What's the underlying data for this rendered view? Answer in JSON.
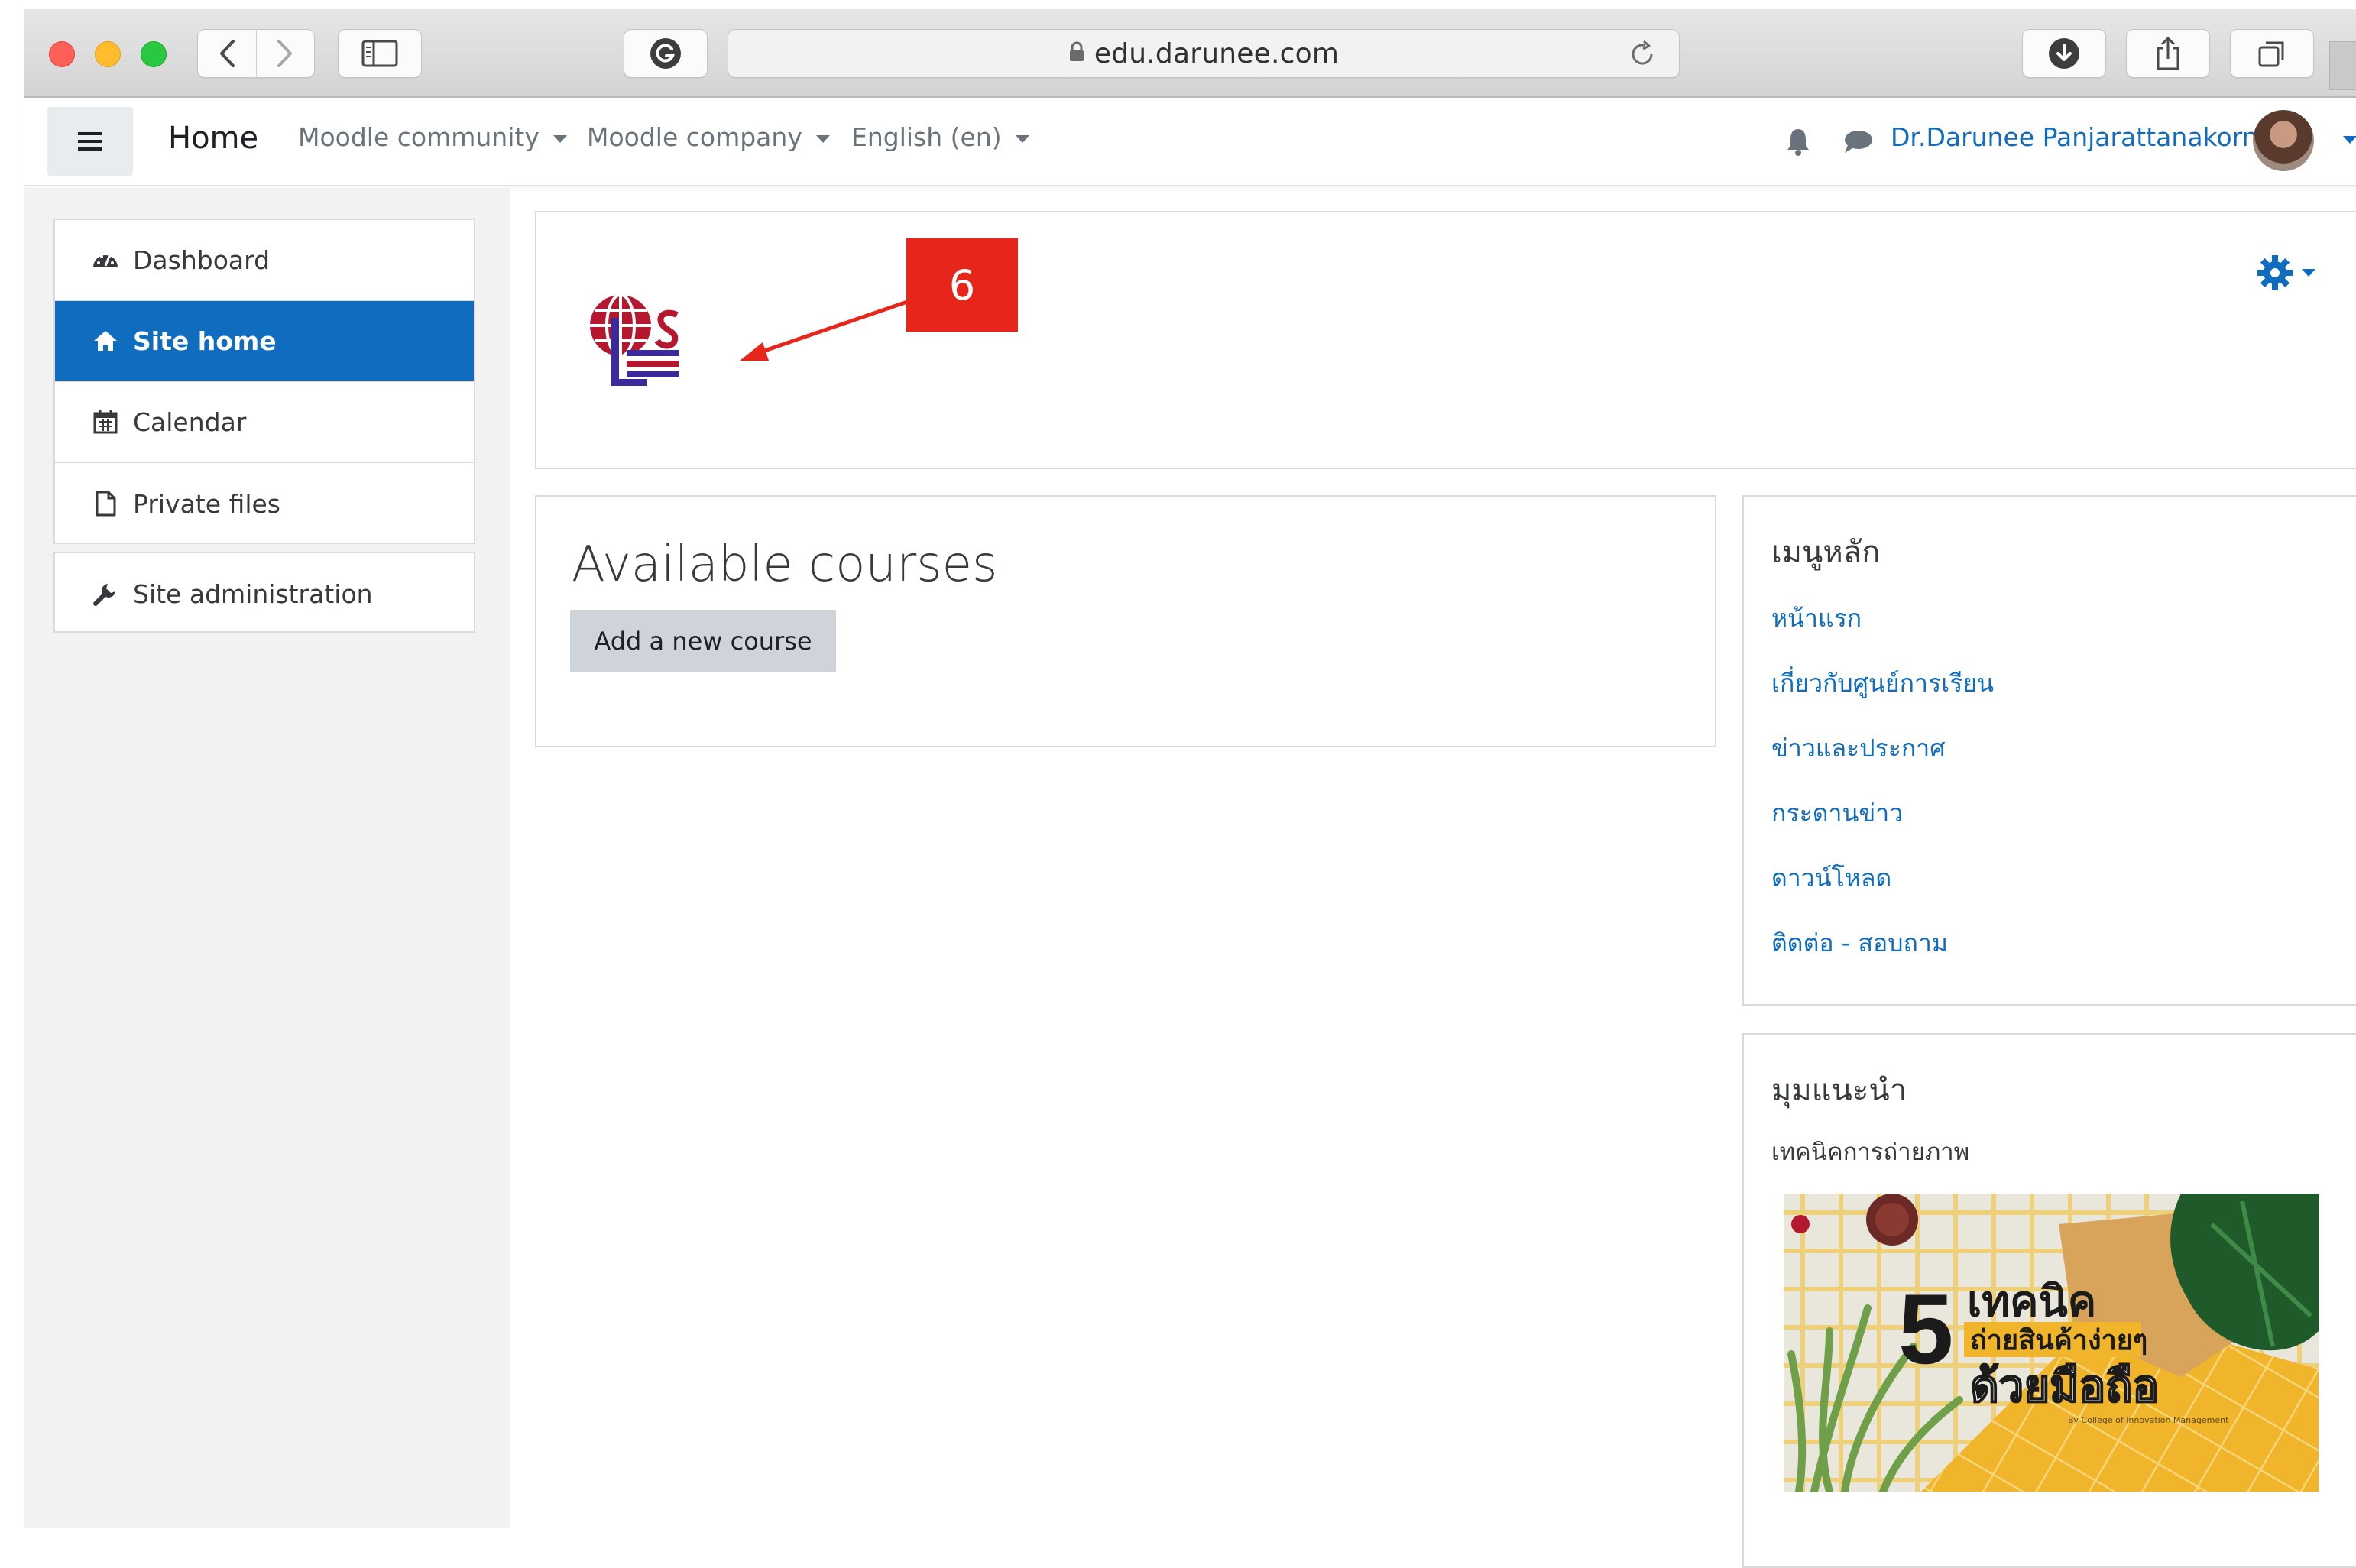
{
  "browser": {
    "url": "edu.darunee.com",
    "icons": {
      "back": "chevron-left-icon",
      "forward": "chevron-right-icon",
      "sidebar": "sidebar-icon",
      "grammarly": "grammarly-icon",
      "lock": "lock-icon",
      "reload": "reload-icon",
      "download": "download-icon",
      "share": "share-icon",
      "tabs": "tabs-icon"
    }
  },
  "navbar": {
    "home": "Home",
    "community": "Moodle community",
    "company": "Moodle company",
    "language": "English (en)",
    "user_name": "Dr.Darunee Panjarattanakorn"
  },
  "drawer": {
    "items": [
      {
        "label": "Dashboard",
        "icon": "dashboard-icon"
      },
      {
        "label": "Site home",
        "icon": "home-icon",
        "active": true
      },
      {
        "label": "Calendar",
        "icon": "calendar-icon"
      },
      {
        "label": "Private files",
        "icon": "file-icon"
      }
    ],
    "admin": {
      "label": "Site administration",
      "icon": "wrench-icon"
    }
  },
  "main": {
    "callout_number": "6",
    "courses_title": "Available courses",
    "add_course_label": "Add a new course"
  },
  "blocks": {
    "main_menu": {
      "title": "เมนูหลัก",
      "links": [
        "หน้าแรก",
        "เกี่ยวกับศูนย์การเรียน",
        "ข่าวและประกาศ",
        "กระดานข่าว",
        "ดาวน์โหลด",
        "ติดต่อ - สอบถาม"
      ]
    },
    "recommended": {
      "title": "มุมแนะนำ",
      "subtitle": "เทคนิคการถ่ายภาพ",
      "promo": {
        "number": "5",
        "line1": "เทคนิค",
        "line2": "ถ่ายสินค้าง่ายๆ",
        "line3": "ด้วยมือถือ",
        "credit": "By College of Innovation Management"
      }
    }
  },
  "colors": {
    "primary": "#0f6cbf",
    "callout": "#e8251a",
    "drawer_bg": "#f2f2f2"
  }
}
